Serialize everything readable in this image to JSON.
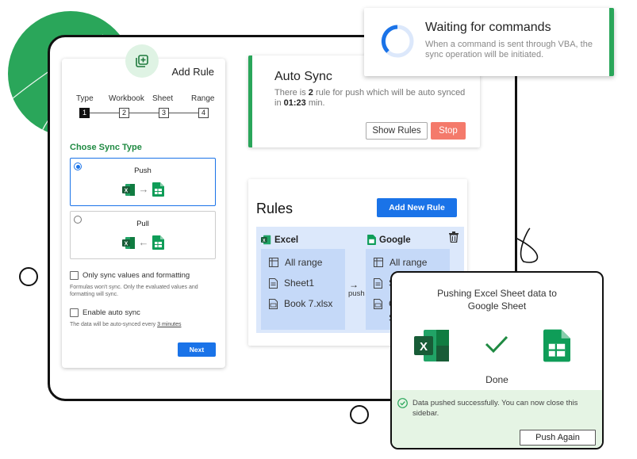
{
  "add_rule": {
    "title": "Add Rule",
    "steps": [
      {
        "label": "Type",
        "num": "1"
      },
      {
        "label": "Workbook",
        "num": "2"
      },
      {
        "label": "Sheet",
        "num": "3"
      },
      {
        "label": "Range",
        "num": "4"
      }
    ],
    "section_title": "Chose Sync Type",
    "options": [
      {
        "label": "Push",
        "selected": true
      },
      {
        "label": "Pull",
        "selected": false
      }
    ],
    "only_sync_label": "Only sync values and formatting",
    "only_sync_note": "Formulas won't sync. Only the evaluated values and formatting will sync.",
    "auto_sync_label": "Enable auto sync",
    "auto_sync_note_prefix": "The data will be auto-synced every ",
    "auto_sync_note_link": "3 minutes",
    "next_label": "Next"
  },
  "auto_sync": {
    "title": "Auto Sync",
    "text_prefix": "There is ",
    "count": "2",
    "text_mid": " rule for push which will be auto synced in ",
    "time": "01:23",
    "text_suffix": " min.",
    "show_rules_label": "Show Rules",
    "stop_label": "Stop"
  },
  "rules": {
    "title": "Rules",
    "add_label": "Add New Rule",
    "source_head": "Excel",
    "target_head": "Google",
    "source_items": [
      "All range",
      "Sheet1",
      "Book 7.xlsx"
    ],
    "target_items": [
      "All range",
      "S",
      "C",
      "S"
    ],
    "direction": "push"
  },
  "waiting": {
    "title": "Waiting for commands",
    "text": "When a command is sent through VBA, the sync operation will be initiated."
  },
  "pushing": {
    "message_line1": "Pushing Excel Sheet data to",
    "message_line2": "Google Sheet",
    "status": "Done",
    "success_text": "Data pushed successfully. You can now close this sidebar.",
    "push_again_label": "Push Again"
  },
  "colors": {
    "brand_green": "#2aa65a",
    "primary_blue": "#1a73e8",
    "stop_red": "#f47a6b",
    "rule_box_bg": "#dce8fb",
    "success_bg": "#e5f4e4"
  }
}
